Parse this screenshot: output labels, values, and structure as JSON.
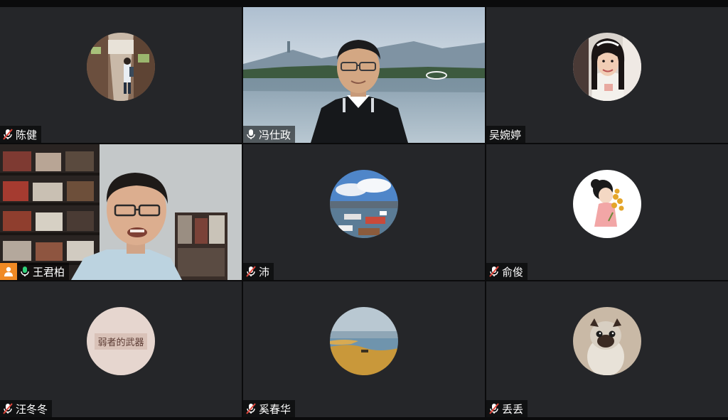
{
  "participants": [
    {
      "name": "陈健",
      "mic": "muted",
      "avatar": "alley-photo-avatar"
    },
    {
      "name": "冯仕政",
      "mic": "on",
      "avatar": "lake-background-video"
    },
    {
      "name": "吴婉婷",
      "mic": "none",
      "avatar": "woman-portrait-avatar"
    },
    {
      "name": "王君柏",
      "mic": "on",
      "host": true,
      "avatar": "bookshelf-video"
    },
    {
      "name": "沛",
      "mic": "muted",
      "avatar": "harbor-photo-avatar"
    },
    {
      "name": "俞俊",
      "mic": "muted",
      "avatar": "cartoon-girl-avatar"
    },
    {
      "name": "汪冬冬",
      "mic": "muted",
      "avatar": "book-cover-avatar",
      "avatar_text": "弱者的武器"
    },
    {
      "name": "奚春华",
      "mic": "muted",
      "avatar": "beach-photo-avatar"
    },
    {
      "name": "丢丢",
      "mic": "muted",
      "avatar": "pug-photo-avatar"
    }
  ],
  "colors": {
    "tile_bg": "#252629",
    "active_border": "#19b58d",
    "host_badge": "#f08a24",
    "mic_muted": "#e0453a",
    "mic_on": "#ffffff"
  }
}
